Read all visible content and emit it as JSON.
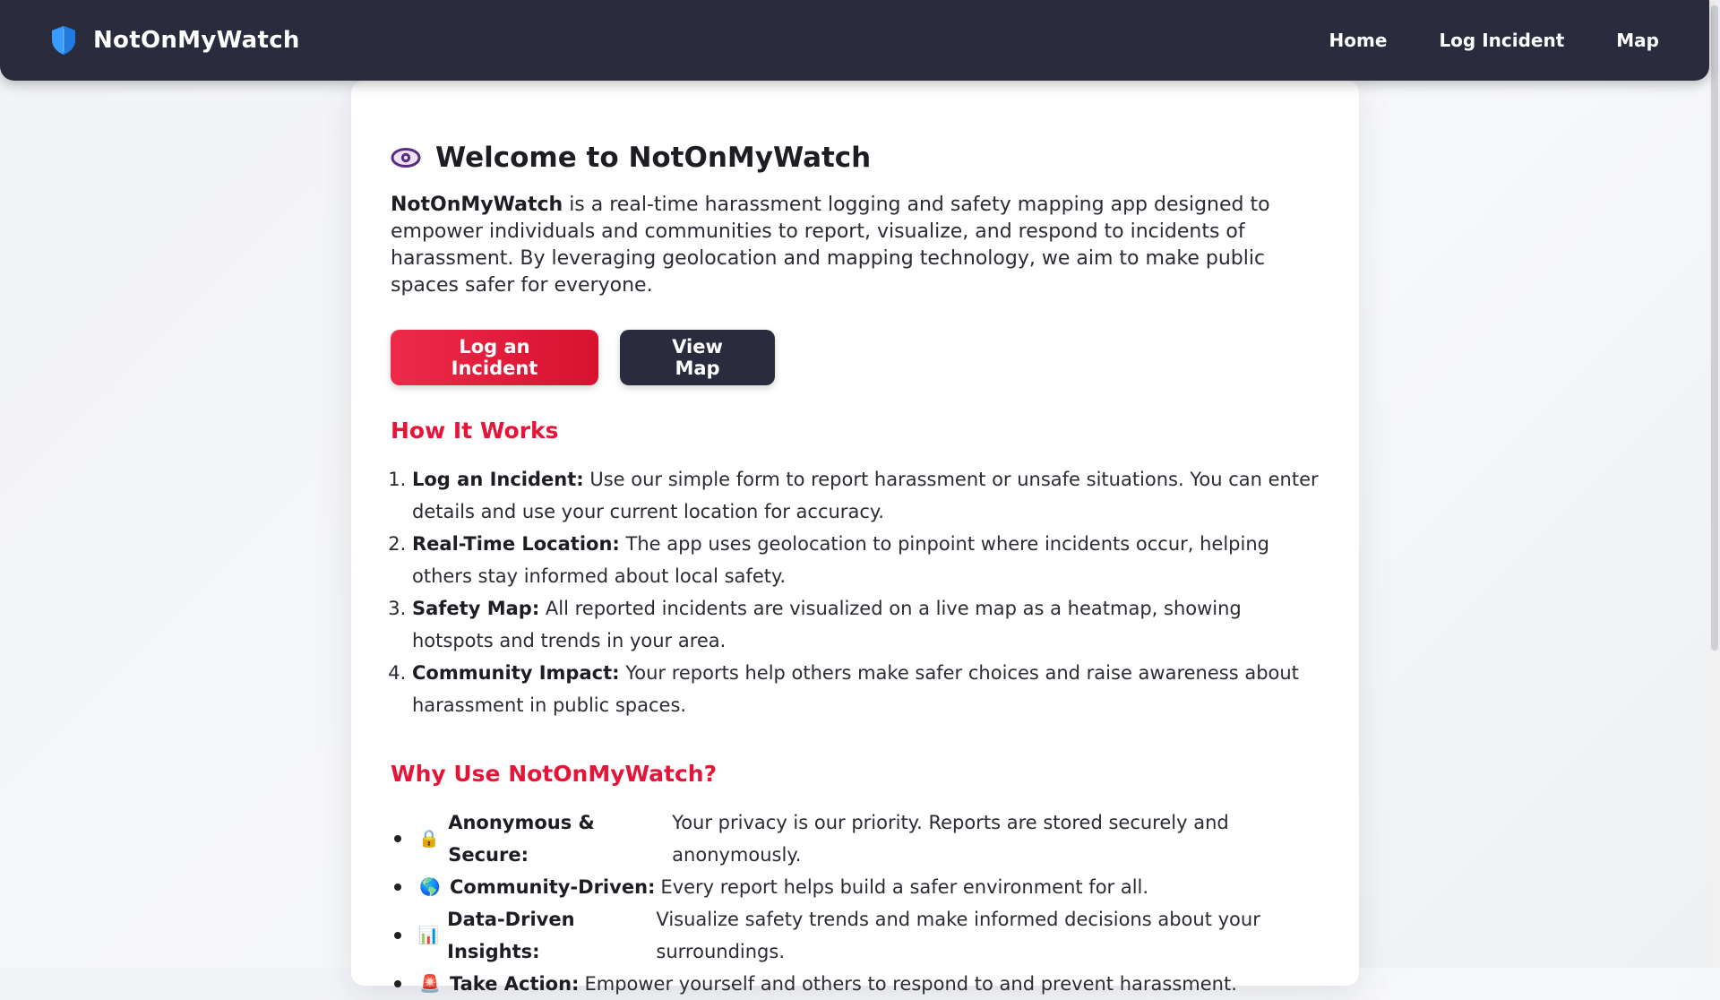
{
  "nav": {
    "brand": "NotOnMyWatch",
    "links": [
      {
        "label": "Home"
      },
      {
        "label": "Log Incident"
      },
      {
        "label": "Map"
      }
    ]
  },
  "welcome": {
    "title": "Welcome to NotOnMyWatch",
    "intro_bold": "NotOnMyWatch",
    "intro_rest": " is a real-time harassment logging and safety mapping app designed to empower individuals and communities to report, visualize, and respond to incidents of harassment. By leveraging geolocation and mapping technology, we aim to make public spaces safer for everyone."
  },
  "actions": {
    "log_label": "Log an Incident",
    "map_label": "View Map"
  },
  "how": {
    "heading": "How It Works",
    "items": [
      {
        "title": "Log an Incident:",
        "text": " Use our simple form to report harassment or unsafe situations. You can enter details and use your current location for accuracy."
      },
      {
        "title": "Real-Time Location:",
        "text": " The app uses geolocation to pinpoint where incidents occur, helping others stay informed about local safety."
      },
      {
        "title": "Safety Map:",
        "text": " All reported incidents are visualized on a live map as a heatmap, showing hotspots and trends in your area."
      },
      {
        "title": "Community Impact:",
        "text": " Your reports help others make safer choices and raise awareness about harassment in public spaces."
      }
    ]
  },
  "why": {
    "heading": "Why Use NotOnMyWatch?",
    "items": [
      {
        "emoji": "🔒",
        "title": "Anonymous & Secure:",
        "text": "Your privacy is our priority. Reports are stored securely and anonymously."
      },
      {
        "emoji": "🌎",
        "title": "Community-Driven:",
        "text": "Every report helps build a safer environment for all."
      },
      {
        "emoji": "📊",
        "title": "Data-Driven Insights:",
        "text": "Visualize safety trends and make informed decisions about your surroundings."
      },
      {
        "emoji": "🚨",
        "title": "Take Action:",
        "text": "Empower yourself and others to respond to and prevent harassment."
      }
    ]
  },
  "colors": {
    "nav_bg": "#2a2c3e",
    "accent_red": "#e5153a",
    "shield_blue": "#3b9cff"
  }
}
